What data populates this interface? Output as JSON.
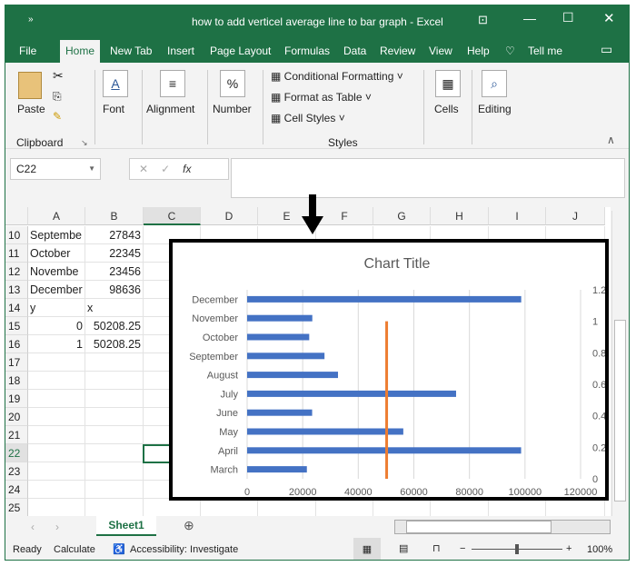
{
  "window": {
    "title": "how to add verticel average line to bar graph  -  Excel"
  },
  "tabs": [
    "File",
    "Home",
    "New Tab",
    "Insert",
    "Page Layout",
    "Formulas",
    "Data",
    "Review",
    "View",
    "Help",
    "Tell me"
  ],
  "ribbon": {
    "paste": "Paste",
    "clipboard": "Clipboard",
    "font": "Font",
    "alignment": "Alignment",
    "number": "Number",
    "conditional_formatting": "Conditional Formatting",
    "format_as_table": "Format as Table",
    "cell_styles": "Cell Styles",
    "styles": "Styles",
    "cells": "Cells",
    "editing": "Editing"
  },
  "formula_bar": {
    "name_box": "C22",
    "formula": ""
  },
  "columns": [
    "A",
    "B",
    "C",
    "D",
    "E",
    "F",
    "G",
    "H",
    "I",
    "J"
  ],
  "rows": [
    {
      "n": "10",
      "a": "Septembe",
      "b": "27843"
    },
    {
      "n": "11",
      "a": "October",
      "b": "22345"
    },
    {
      "n": "12",
      "a": "Novembe",
      "b": "23456"
    },
    {
      "n": "13",
      "a": "December",
      "b": "98636"
    },
    {
      "n": "14",
      "a": "y",
      "b": "x"
    },
    {
      "n": "15",
      "a": "0",
      "b": "50208.25"
    },
    {
      "n": "16",
      "a": "1",
      "b": "50208.25"
    },
    {
      "n": "17",
      "a": "",
      "b": ""
    },
    {
      "n": "18",
      "a": "",
      "b": ""
    },
    {
      "n": "19",
      "a": "",
      "b": ""
    },
    {
      "n": "20",
      "a": "",
      "b": ""
    },
    {
      "n": "21",
      "a": "",
      "b": ""
    },
    {
      "n": "22",
      "a": "",
      "b": ""
    },
    {
      "n": "23",
      "a": "",
      "b": ""
    },
    {
      "n": "24",
      "a": "",
      "b": ""
    },
    {
      "n": "25",
      "a": "",
      "b": ""
    }
  ],
  "sheet_tab": "Sheet1",
  "status": {
    "ready": "Ready",
    "calculate": "Calculate",
    "accessibility": "Accessibility: Investigate",
    "zoom": "100%"
  },
  "chart_data": {
    "type": "bar",
    "title": "Chart Title",
    "categories": [
      "March",
      "April",
      "May",
      "June",
      "July",
      "August",
      "September",
      "October",
      "November",
      "December"
    ],
    "values": [
      21500,
      98600,
      56200,
      23400,
      75200,
      32700,
      27843,
      22345,
      23456,
      98636
    ],
    "xlim": [
      0,
      120000
    ],
    "xticks": [
      "0",
      "20000",
      "40000",
      "60000",
      "80000",
      "100000",
      "120000"
    ],
    "y2lim": [
      0,
      1.2
    ],
    "y2ticks": [
      "0",
      "0.2",
      "0.4",
      "0.6",
      "0.8",
      "1",
      "1.2"
    ],
    "average_line": {
      "x": 50208.25,
      "y": [
        0,
        1
      ]
    },
    "colors": {
      "bar": "#4472c4",
      "line": "#ed7d31"
    }
  }
}
